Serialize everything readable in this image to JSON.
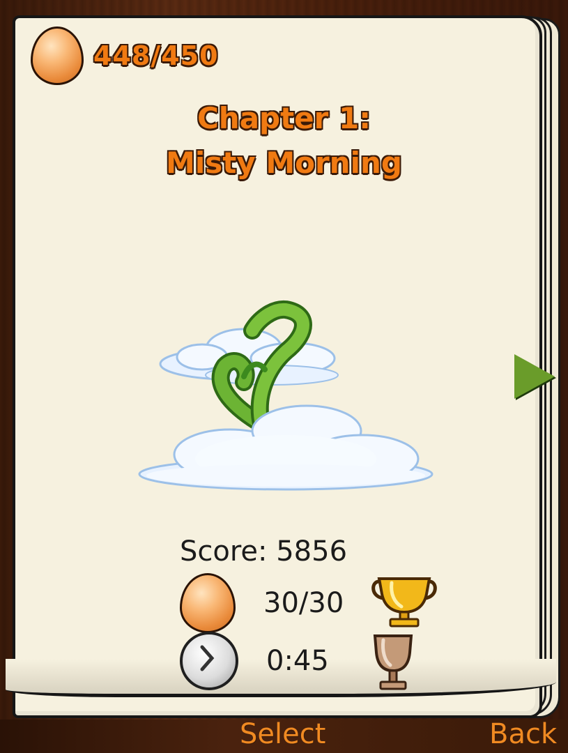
{
  "egg_counter": {
    "icon": "egg-icon",
    "value": "448/450"
  },
  "chapter": {
    "title_line1": "Chapter 1:",
    "title_line2": "Misty Morning"
  },
  "stats": {
    "score": "Score: 5856",
    "eggs": {
      "icon": "egg-icon",
      "value": "30/30",
      "trophy": "gold-trophy-icon"
    },
    "time": {
      "icon": "clock-icon",
      "value": "0:45",
      "trophy": "bronze-trophy-icon"
    }
  },
  "navigation": {
    "next_icon": "right-arrow-icon"
  },
  "softkeys": {
    "left": "Select",
    "right": "Back"
  },
  "colors": {
    "title": "#f07a12",
    "page": "#f6f1df",
    "arrow": "#6a9c2a",
    "wood": "#4a220e"
  }
}
